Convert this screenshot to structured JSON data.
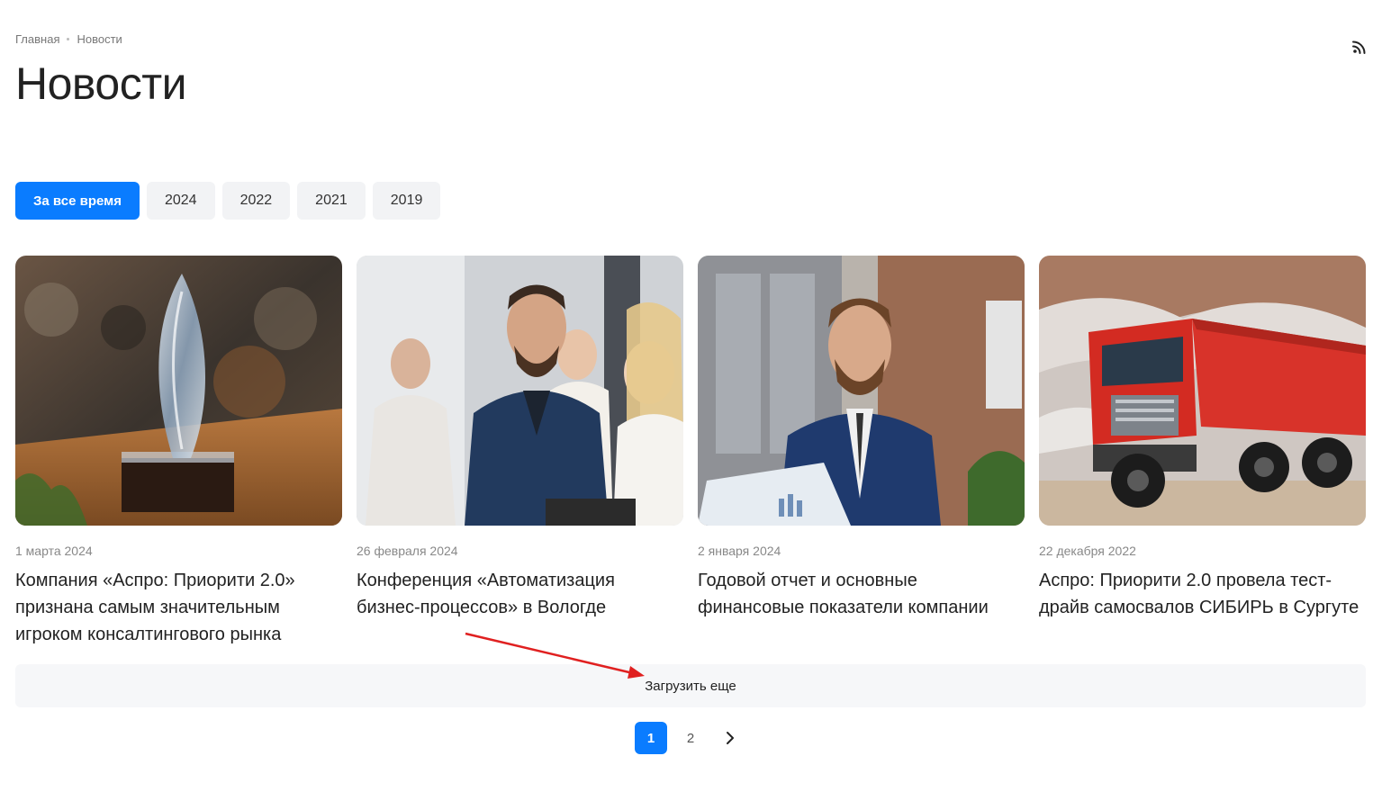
{
  "breadcrumb": {
    "home": "Главная",
    "current": "Новости"
  },
  "page_title": "Новости",
  "icons": {
    "rss": "rss-icon",
    "next": "chevron-right-icon"
  },
  "filters": [
    "За все время",
    "2024",
    "2022",
    "2021",
    "2019"
  ],
  "active_filter": "За все время",
  "accent_color": "#0a7cff",
  "news": [
    {
      "date": "1 марта 2024",
      "title": "Компания «Аспро: Приорити 2.0» признана самым значительным игроком консалтингового рынка",
      "image": "crystal-award-photo"
    },
    {
      "date": "26 февраля 2024",
      "title": "Конференция «Автоматизация бизнес-процессов» в Вологде",
      "image": "conference-audience-photo"
    },
    {
      "date": "2 января 2024",
      "title": "Годовой отчет и основные финансовые показатели компании",
      "image": "businessman-report-photo"
    },
    {
      "date": "22 декабря 2022",
      "title": "Аспро: Приорити 2.0 провела тест-драйв самосвалов СИБИРЬ в Сургуте",
      "image": "red-dump-truck-photo"
    }
  ],
  "load_more_label": "Загрузить еще",
  "pagination": {
    "pages": [
      "1",
      "2"
    ],
    "current": "1"
  }
}
